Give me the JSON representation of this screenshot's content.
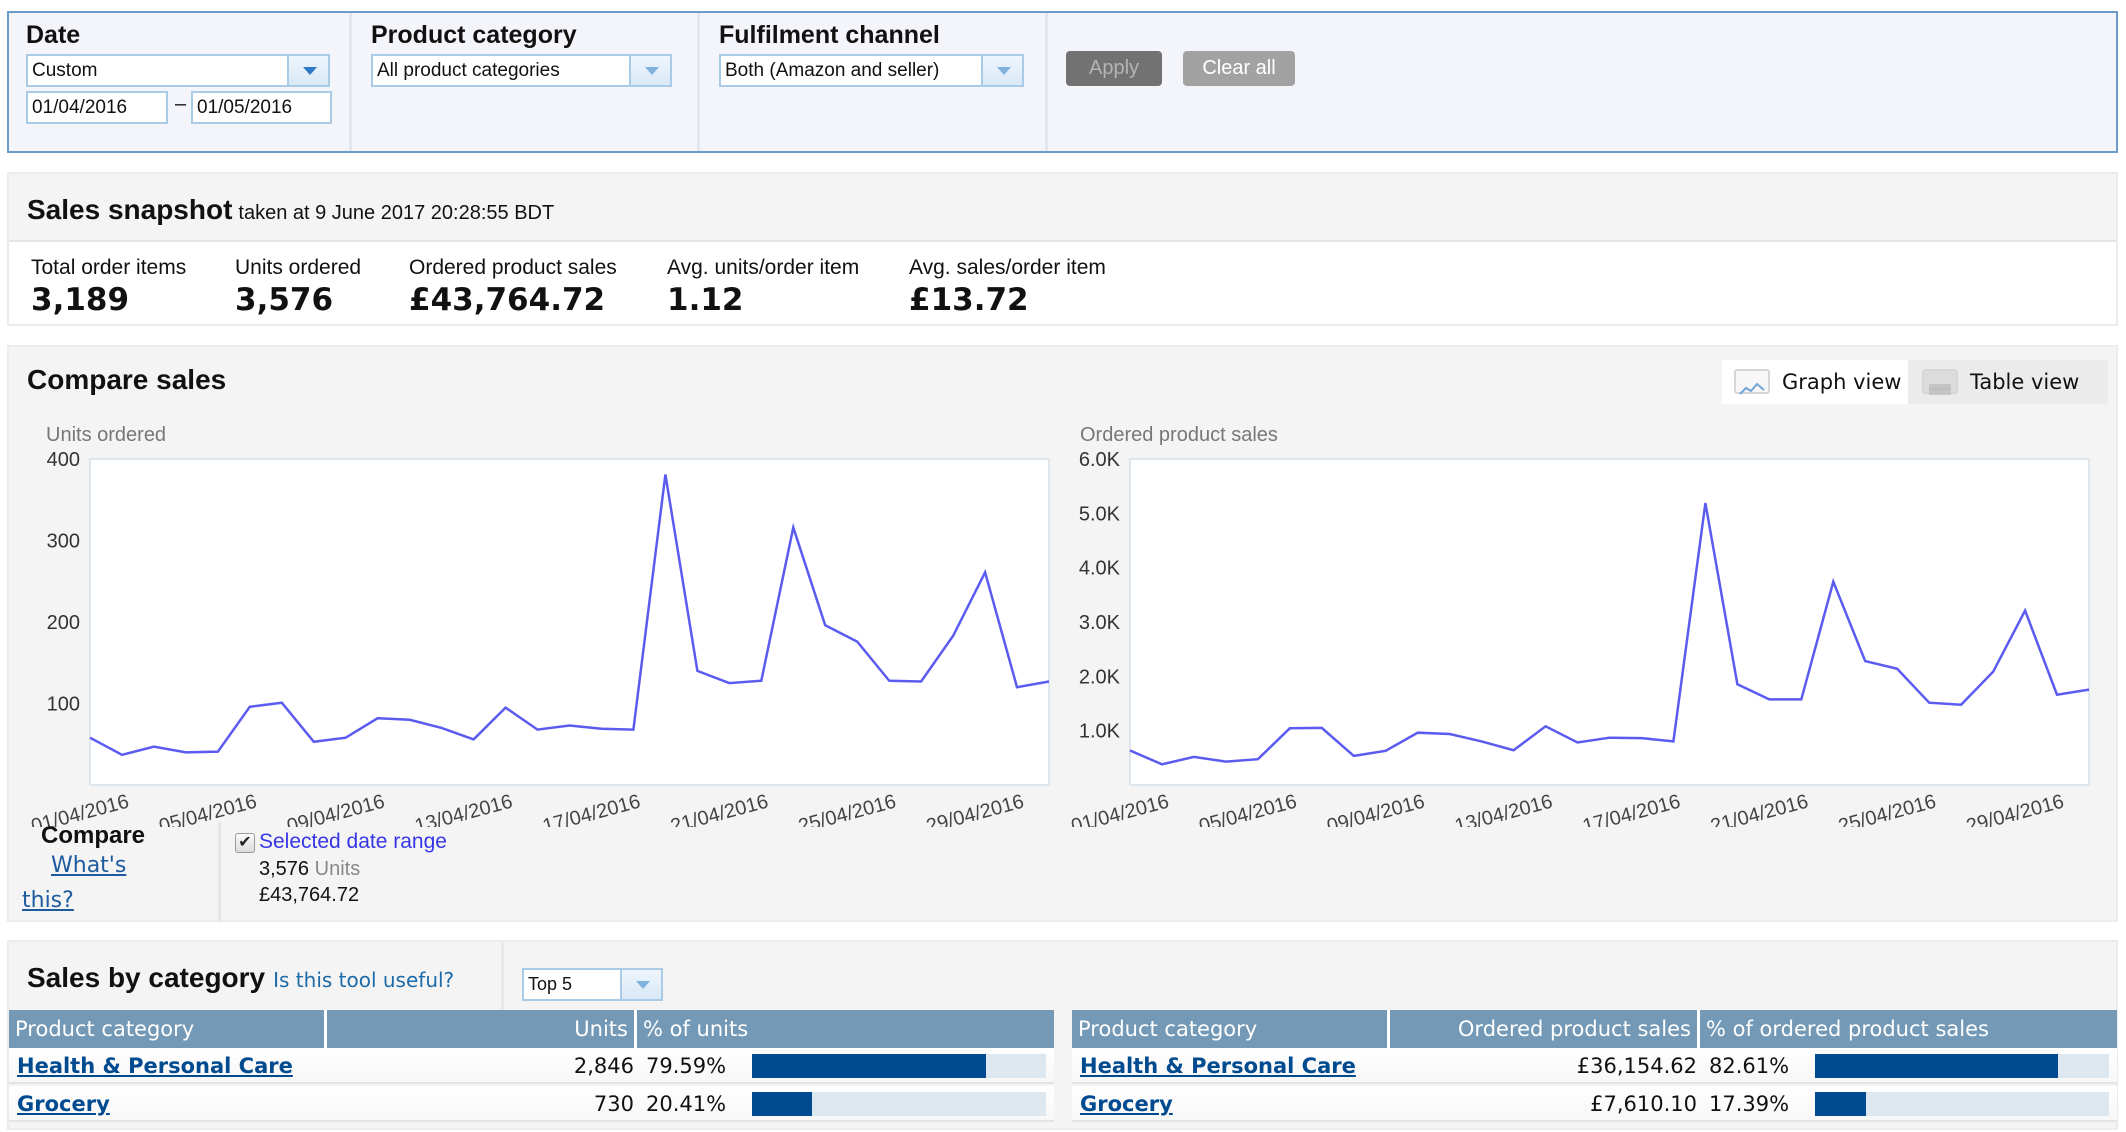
{
  "filters": {
    "date": {
      "label": "Date",
      "selected": "Custom",
      "from": "01/04/2016",
      "separator": "–",
      "to": "01/05/2016"
    },
    "product_category": {
      "label": "Product category",
      "selected": "All product categories"
    },
    "fulfilment_channel": {
      "label": "Fulfilment channel",
      "selected": "Both (Amazon and seller)"
    },
    "apply_label": "Apply",
    "clear_label": "Clear all"
  },
  "snapshot": {
    "title": "Sales snapshot",
    "subtitle": "taken at 9 June 2017 20:28:55 BDT",
    "metrics": [
      {
        "label": "Total order items",
        "value": "3,189"
      },
      {
        "label": "Units ordered",
        "value": "3,576"
      },
      {
        "label": "Ordered product sales",
        "value": "£43,764.72"
      },
      {
        "label": "Avg. units/order item",
        "value": "1.12"
      },
      {
        "label": "Avg. sales/order item",
        "value": "£13.72"
      }
    ]
  },
  "compare": {
    "title": "Compare sales",
    "graph_view_label": "Graph view",
    "table_view_label": "Table view",
    "compare_label": "Compare",
    "whats_this_1": "What's",
    "whats_this_2": "this?",
    "selected_range_label": "Selected date range",
    "selected_units_value": "3,576",
    "selected_units_suffix": "Units",
    "selected_sales": "£43,764.72",
    "line_color": "#5b5bf0"
  },
  "chart_data": [
    {
      "type": "line",
      "title": "",
      "ylabel": "Units ordered",
      "xlabel": "",
      "ylim": [
        0,
        400
      ],
      "yticks": [
        100,
        200,
        300,
        400
      ],
      "ytick_labels": [
        "100",
        "200",
        "300",
        "400"
      ],
      "grid": false,
      "x": [
        "01/04/2016",
        "02/04/2016",
        "03/04/2016",
        "04/04/2016",
        "05/04/2016",
        "06/04/2016",
        "07/04/2016",
        "08/04/2016",
        "09/04/2016",
        "10/04/2016",
        "11/04/2016",
        "12/04/2016",
        "13/04/2016",
        "14/04/2016",
        "15/04/2016",
        "16/04/2016",
        "17/04/2016",
        "18/04/2016",
        "19/04/2016",
        "20/04/2016",
        "21/04/2016",
        "22/04/2016",
        "23/04/2016",
        "24/04/2016",
        "25/04/2016",
        "26/04/2016",
        "27/04/2016",
        "28/04/2016",
        "29/04/2016",
        "30/04/2016",
        "01/05/2016"
      ],
      "xtick_labels": [
        "01/04/2016",
        "05/04/2016",
        "09/04/2016",
        "13/04/2016",
        "17/04/2016",
        "21/04/2016",
        "25/04/2016",
        "29/04/2016"
      ],
      "series": [
        {
          "name": "Selected date range",
          "values": [
            58,
            37,
            47,
            40,
            41,
            96,
            101,
            53,
            58,
            82,
            80,
            70,
            56,
            95,
            68,
            73,
            69,
            68,
            381,
            140,
            125,
            128,
            316,
            196,
            176,
            128,
            127,
            183,
            261,
            120,
            127
          ]
        }
      ]
    },
    {
      "type": "line",
      "title": "",
      "ylabel": "Ordered product sales",
      "xlabel": "",
      "ylim": [
        0,
        6000
      ],
      "yticks": [
        1000,
        2000,
        3000,
        4000,
        5000,
        6000
      ],
      "ytick_labels": [
        "1.0K",
        "2.0K",
        "3.0K",
        "4.0K",
        "5.0K",
        "6.0K"
      ],
      "grid": false,
      "x": [
        "01/04/2016",
        "02/04/2016",
        "03/04/2016",
        "04/04/2016",
        "05/04/2016",
        "06/04/2016",
        "07/04/2016",
        "08/04/2016",
        "09/04/2016",
        "10/04/2016",
        "11/04/2016",
        "12/04/2016",
        "13/04/2016",
        "14/04/2016",
        "15/04/2016",
        "16/04/2016",
        "17/04/2016",
        "18/04/2016",
        "19/04/2016",
        "20/04/2016",
        "21/04/2016",
        "22/04/2016",
        "23/04/2016",
        "24/04/2016",
        "25/04/2016",
        "26/04/2016",
        "27/04/2016",
        "28/04/2016",
        "29/04/2016",
        "30/04/2016",
        "01/05/2016"
      ],
      "xtick_labels": [
        "01/04/2016",
        "05/04/2016",
        "09/04/2016",
        "13/04/2016",
        "17/04/2016",
        "21/04/2016",
        "25/04/2016",
        "29/04/2016"
      ],
      "series": [
        {
          "name": "Selected date range",
          "values": [
            635,
            381,
            517,
            431,
            474,
            1043,
            1050,
            536,
            629,
            963,
            939,
            802,
            640,
            1080,
            783,
            870,
            863,
            802,
            5188,
            1854,
            1576,
            1576,
            3741,
            2281,
            2139,
            1514,
            1477,
            2083,
            3209,
            1662,
            1755
          ]
        }
      ]
    }
  ],
  "by_category": {
    "title": "Sales by category",
    "feedback_link": "Is this tool useful?",
    "top_select": "Top 5",
    "units_table": {
      "headers": [
        "Product category",
        "Units",
        "% of units"
      ],
      "rows": [
        {
          "category": "Health & Personal Care",
          "value": "2,846",
          "percent": "79.59%",
          "fraction": 0.7959
        },
        {
          "category": "Grocery",
          "value": "730",
          "percent": "20.41%",
          "fraction": 0.2041
        }
      ]
    },
    "sales_table": {
      "headers": [
        "Product category",
        "Ordered product sales",
        "% of ordered product sales"
      ],
      "rows": [
        {
          "category": "Health & Personal Care",
          "value": "£36,154.62",
          "percent": "82.61%",
          "fraction": 0.8261
        },
        {
          "category": "Grocery",
          "value": "£7,610.10",
          "percent": "17.39%",
          "fraction": 0.1739
        }
      ]
    }
  }
}
